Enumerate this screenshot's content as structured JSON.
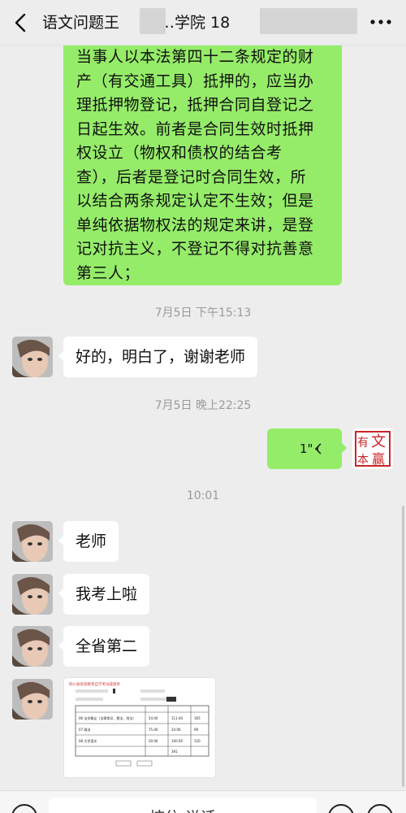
{
  "header": {
    "title_part1": "语文问题王",
    "title_part2": "法…学院 18"
  },
  "messages": {
    "long_text": [
      "当事人以本法第四十二条规定的财",
      "产（有交通工具）抵押的，应当办",
      "理抵押物登记，抵押合同自登记之",
      "日起生效。前者是合同生效时抵押",
      "权设立（物权和债权的结合考",
      "查），后者是登记时合同生效，所",
      "以结合两条规定认定不生效；但是",
      "单纯依据物权法的规定来讲，是登",
      "记对抗主义，不登记不得对抗善意",
      "第三人；"
    ],
    "time1": "7月5日 下午15:13",
    "reply1": "好的，明白了，谢谢老师",
    "time2": "7月5日 晚上22:25",
    "voice_duration": "1\"",
    "time3": "10:01",
    "msg_teacher": "老师",
    "msg_passed": "我考上啦",
    "msg_rank": "全省第二"
  },
  "my_avatar": {
    "seal_chars": [
      "文",
      "有",
      "赢",
      "本"
    ]
  },
  "score_image": {
    "header_line": "四川省高等教育自学考试成绩单",
    "rows": [
      {
        "subject": "06 法学概论（法律常识、税法、刑法）",
        "score": "54.00",
        "total": "111.00",
        "sum": "165"
      },
      {
        "subject": "07 政治",
        "score": "75.00",
        "total": "24.00",
        "sum": "99"
      },
      {
        "subject": "08 大学语文",
        "score": "20.00",
        "total": "100.00",
        "sum": "120"
      }
    ],
    "grand_total": "391"
  },
  "input_bar": {
    "hold_to_talk": "按住 说话"
  }
}
